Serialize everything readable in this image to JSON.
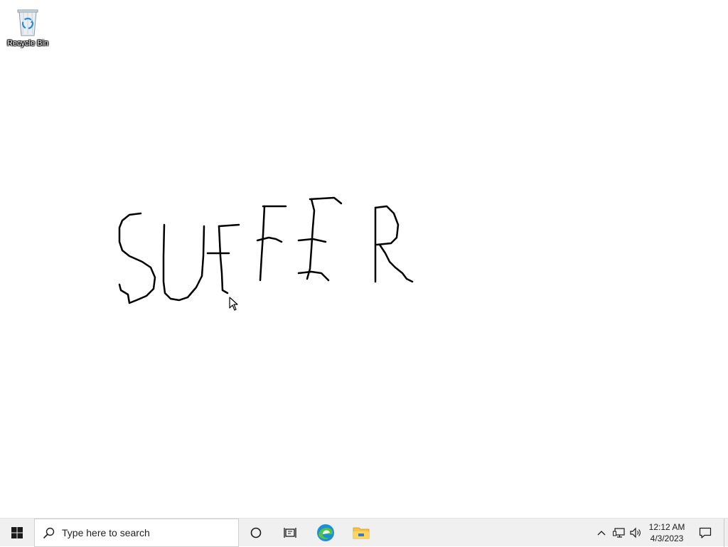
{
  "desktop": {
    "icons": [
      {
        "label": "Recycle Bin",
        "icon": "recycle-bin-icon"
      }
    ],
    "drawing_text": "SUFFER"
  },
  "taskbar": {
    "start_icon": "windows-logo-icon",
    "search": {
      "placeholder": "Type here to search",
      "icon": "search-icon"
    },
    "pinned": [
      {
        "name": "cortana",
        "icon": "cortana-circle-icon"
      },
      {
        "name": "task-view",
        "icon": "task-view-icon"
      },
      {
        "name": "edge",
        "icon": "edge-browser-icon"
      },
      {
        "name": "file-explorer",
        "icon": "folder-icon"
      }
    ],
    "tray": {
      "icons": [
        "chevron-up-icon",
        "network-icon",
        "volume-icon"
      ]
    },
    "clock": {
      "time": "12:12 AM",
      "date": "4/3/2023"
    },
    "notification_icon": "notification-icon"
  },
  "colors": {
    "taskbar_bg": "#f0f0f0",
    "desktop_bg": "#ffffff",
    "edge_blue": "#1d8ed8",
    "edge_green": "#4fc34b",
    "folder_yellow": "#f4c542"
  }
}
